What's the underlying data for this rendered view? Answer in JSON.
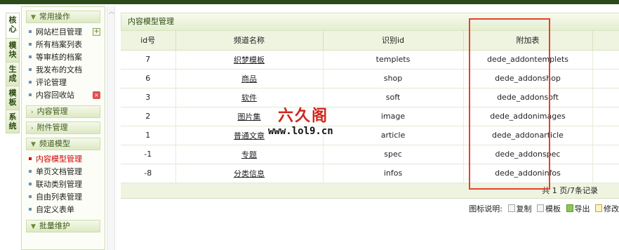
{
  "vertical_tabs": [
    "核心",
    "模块",
    "生成",
    "模板",
    "系统"
  ],
  "menu": {
    "groups": [
      {
        "header": "常用操作",
        "items": [
          "网站栏目管理",
          "所有档案列表",
          "等审核的档案",
          "我发布的文档",
          "评论管理",
          "内容回收站"
        ]
      },
      {
        "header": "内容管理"
      },
      {
        "header": "附件管理"
      },
      {
        "header": "频道模型",
        "items": [
          "内容模型管理",
          "单页文档管理",
          "联动类别管理",
          "自由列表管理",
          "自定义表单"
        ]
      },
      {
        "header": "批量维护"
      }
    ],
    "active_item": "内容模型管理"
  },
  "main": {
    "title": "内容模型管理",
    "columns": [
      "id号",
      "频道名称",
      "识别id",
      "附加表"
    ],
    "rows": [
      [
        "7",
        "织梦模板",
        "templets",
        "dede_addontemplets"
      ],
      [
        "6",
        "商品",
        "shop",
        "dede_addonshop"
      ],
      [
        "3",
        "软件",
        "soft",
        "dede_addonsoft"
      ],
      [
        "2",
        "图片集",
        "image",
        "dede_addonimages"
      ],
      [
        "1",
        "普通文章",
        "article",
        "dede_addonarticle"
      ],
      [
        "-1",
        "专题",
        "spec",
        "dede_addonspec"
      ],
      [
        "-8",
        "分类信息",
        "infos",
        "dede_addoninfos"
      ]
    ],
    "pager": "共 1 页/7条记录",
    "legend_label": "图标说明:",
    "legend_items": [
      "复制",
      "模板",
      "导出",
      "修改"
    ]
  },
  "watermark": {
    "logo_text": "六久阁",
    "url": "www.lol9.cn"
  },
  "colors": {
    "accent_green": "#2b4a1a",
    "highlight_red": "#e8402a",
    "active_item": "#d40000"
  }
}
